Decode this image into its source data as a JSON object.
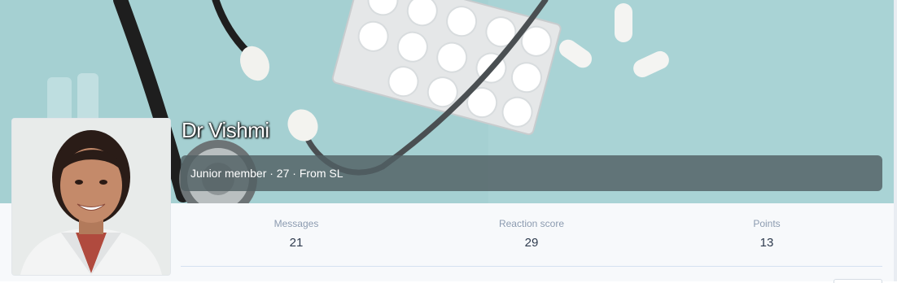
{
  "profile": {
    "name": "Dr Vishmi",
    "member_line": "Junior member · 27 · From SL"
  },
  "stats": [
    {
      "label": "Messages",
      "value": "21"
    },
    {
      "label": "Reaction score",
      "value": "29"
    },
    {
      "label": "Points",
      "value": "13"
    }
  ]
}
